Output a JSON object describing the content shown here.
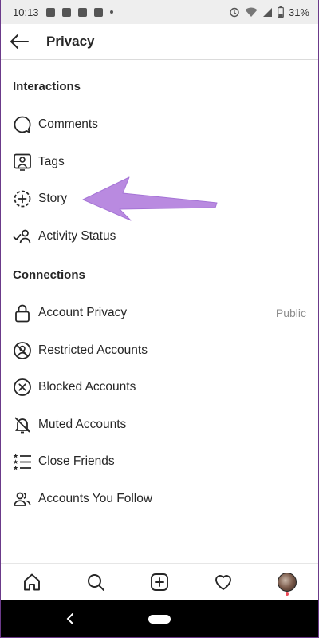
{
  "status_bar": {
    "time": "10:13",
    "battery": "31%"
  },
  "header": {
    "title": "Privacy",
    "back_icon": "arrow-left-icon"
  },
  "interactions": {
    "title": "Interactions",
    "items": [
      {
        "label": "Comments",
        "icon": "comment-icon"
      },
      {
        "label": "Tags",
        "icon": "tag-person-icon"
      },
      {
        "label": "Story",
        "icon": "story-add-icon"
      },
      {
        "label": "Activity Status",
        "icon": "activity-status-icon"
      }
    ]
  },
  "connections": {
    "title": "Connections",
    "items": [
      {
        "label": "Account Privacy",
        "icon": "lock-icon",
        "value": "Public"
      },
      {
        "label": "Restricted Accounts",
        "icon": "restricted-icon"
      },
      {
        "label": "Blocked Accounts",
        "icon": "blocked-icon"
      },
      {
        "label": "Muted Accounts",
        "icon": "muted-bell-icon"
      },
      {
        "label": "Close Friends",
        "icon": "close-friends-list-icon"
      },
      {
        "label": "Accounts You Follow",
        "icon": "following-people-icon"
      }
    ]
  },
  "annotation": {
    "arrow_color": "#b98ae0"
  },
  "bottom_nav": {
    "items": [
      "home-icon",
      "search-icon",
      "new-post-icon",
      "activity-heart-icon",
      "profile-avatar"
    ]
  },
  "colors": {
    "text": "#262626",
    "secondary": "#8e8e8e",
    "status_bar_bg": "#eeeeee",
    "system_nav_bg": "#000000"
  }
}
